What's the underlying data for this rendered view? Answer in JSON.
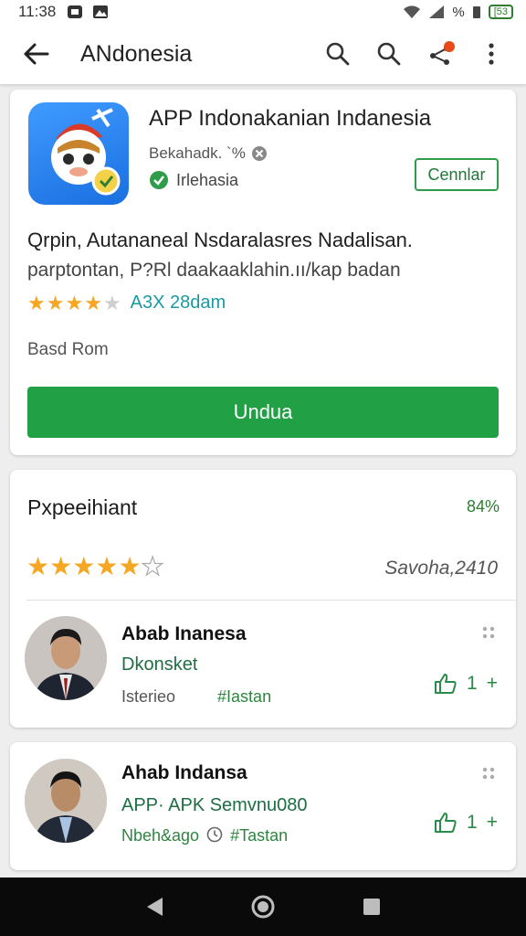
{
  "status_bar": {
    "time": "11:38",
    "indicator": "%",
    "battery": "[53"
  },
  "app_bar": {
    "title": "ANdonesia"
  },
  "app": {
    "name": "APP Indonakanian Indanesia",
    "developer": "Bekahadk. `%",
    "region": "Irlehasia",
    "open_label": "Cennlar",
    "description_line1": "Qrpin, Autananeal Nsdaralasres Nadalisan.",
    "description_line2": "parptontan, P?Rl daakaaklаhin.ıı/kap badan",
    "rating_count": "A3X 28dam",
    "rating_stars": 4,
    "based_on": "Basd Rom",
    "install_label": "Undua"
  },
  "reviews": {
    "title": "Pxpeeihiant",
    "percent": "84%",
    "stars": 5,
    "total": "Savoha,2410",
    "items": [
      {
        "name": "Abab Inanesa",
        "subtitle": "Dkonsket",
        "meta_left": "Isterieo",
        "meta_tag": "#Iastan",
        "likes": "1"
      },
      {
        "name": "Ahab Indansa",
        "subtitle": "APP· APK Semvnu080",
        "meta_left": "Nbeh&ago",
        "meta_tag": "#Tastan",
        "likes": "1"
      }
    ]
  },
  "colors": {
    "accent_green": "#22a046",
    "star": "#f5a623",
    "app_icon_blue": "#1a6fe0"
  },
  "icons": [
    "back-arrow-icon",
    "search-icon",
    "share-icon",
    "more-vert-icon",
    "verified-icon",
    "thumb-up-icon",
    "nav-back-icon",
    "nav-home-icon",
    "nav-recents-icon"
  ]
}
